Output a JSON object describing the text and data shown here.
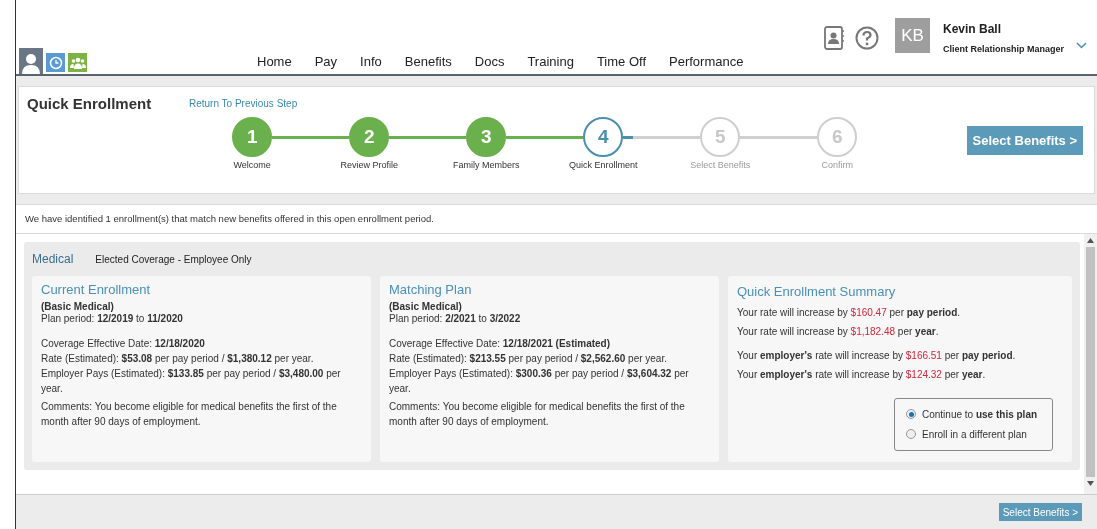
{
  "nav": {
    "items": [
      {
        "label": "Home"
      },
      {
        "label": "Pay"
      },
      {
        "label": "Info"
      },
      {
        "label": "Benefits"
      },
      {
        "label": "Docs"
      },
      {
        "label": "Training"
      },
      {
        "label": "Time Off"
      },
      {
        "label": "Performance"
      }
    ]
  },
  "user": {
    "initials": "KB",
    "name": "Kevin Ball",
    "title": "Client Relationship Manager"
  },
  "page": {
    "title": "Quick Enrollment",
    "back_link": "Return To Previous Step",
    "next_button": "Select Benefits >"
  },
  "steps": [
    {
      "number": "1",
      "label": "Welcome",
      "completed": true,
      "selected": false
    },
    {
      "number": "2",
      "label": "Review Profile",
      "completed": true,
      "selected": false
    },
    {
      "number": "3",
      "label": "Family Members",
      "completed": true,
      "selected": false
    },
    {
      "number": "4",
      "label": "Quick Enrollment",
      "completed": false,
      "selected": true
    },
    {
      "number": "5",
      "label": "Select Benefits",
      "completed": false,
      "selected": false
    },
    {
      "number": "6",
      "label": "Confirm",
      "completed": false,
      "selected": false
    }
  ],
  "info": "We have identified 1 enrollment(s) that match new benefits offered in this open enrollment period.",
  "section": {
    "category": "Medical",
    "coverage": "Elected Coverage - Employee Only"
  },
  "cards": [
    {
      "title": "Current Enrollment",
      "plan": "(Basic Medical)",
      "period": "Plan period: **12/2019** to **11/2020**",
      "details": [
        "Coverage Effective Date: **12/18/2020**",
        "Rate (Estimated): **$53.08** per pay period / **$1,380.12** per year.",
        "Employer Pays (Estimated): **$133.85** per pay period / **$3,480.00** per year."
      ],
      "comments": "Comments: You become eligible for medical benefits the first of the month after 90 days of employment."
    },
    {
      "title": "Matching Plan",
      "plan": "(Basic Medical)",
      "period": "Plan period: **2/2021** to **3/2022**",
      "details": [
        "Coverage Effective Date: **12/18/2021 (Estimated)**",
        "Rate (Estimated): **$213.55** per pay period / **$2,562.60** per year.",
        "Employer Pays (Estimated): **$300.36** per pay period / **$3,604.32** per year."
      ],
      "comments": "Comments: You become eligible for medical benefits the first of the month after 90 days of employment."
    }
  ],
  "summary": {
    "title": "Quick Enrollment Summary",
    "groups": [
      [
        [
          {
            "kind": "plain",
            "text": "Your rate will increase by "
          },
          {
            "kind": "amount",
            "text": "$160.47"
          },
          {
            "kind": "plain",
            "text": " per "
          },
          {
            "kind": "bold",
            "text": "pay period"
          },
          {
            "kind": "plain",
            "text": "."
          }
        ],
        [
          {
            "kind": "plain",
            "text": "Your rate will increase by "
          },
          {
            "kind": "amount",
            "text": "$1,182.48"
          },
          {
            "kind": "plain",
            "text": " per "
          },
          {
            "kind": "bold",
            "text": "year"
          },
          {
            "kind": "plain",
            "text": "."
          }
        ]
      ],
      [
        [
          {
            "kind": "plain",
            "text": "Your "
          },
          {
            "kind": "bold",
            "text": "employer's"
          },
          {
            "kind": "plain",
            "text": " rate will increase by "
          },
          {
            "kind": "amount",
            "text": "$166.51"
          },
          {
            "kind": "plain",
            "text": " per "
          },
          {
            "kind": "bold",
            "text": "pay period"
          },
          {
            "kind": "plain",
            "text": "."
          }
        ],
        [
          {
            "kind": "plain",
            "text": "Your "
          },
          {
            "kind": "bold",
            "text": "employer's"
          },
          {
            "kind": "plain",
            "text": " rate will increase by "
          },
          {
            "kind": "amount",
            "text": "$124.32"
          },
          {
            "kind": "plain",
            "text": " per "
          },
          {
            "kind": "bold",
            "text": "year"
          },
          {
            "kind": "plain",
            "text": "."
          }
        ]
      ]
    ],
    "options": [
      {
        "label": "Continue to **use this plan**",
        "selected": true
      },
      {
        "label": "Enroll in a different plan",
        "selected": false
      }
    ]
  },
  "footer_button": "Select Benefits >"
}
